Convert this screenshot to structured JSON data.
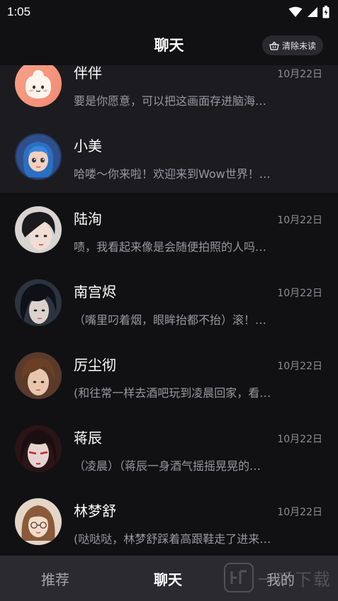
{
  "status_bar": {
    "time": "1:05",
    "icons": [
      "wifi-icon",
      "signal-icon",
      "battery-icon"
    ]
  },
  "header": {
    "title": "聊天",
    "clear_unread_label": "清除未读",
    "clear_icon": "basket-icon"
  },
  "chats": [
    {
      "name": "伴伴",
      "date": "10月22日",
      "preview": "要是你愿意，可以把这画面存进脑海…",
      "pinned": true,
      "avatar": "mascot-avatar"
    },
    {
      "name": "小美",
      "date": "",
      "preview": "哈喽～你来啦！欢迎来到Wow世界！…",
      "pinned": true,
      "avatar": "girl-avatar"
    },
    {
      "name": "陆洵",
      "date": "10月22日",
      "preview": "啧，我看起来像是会随便拍照的人吗…",
      "pinned": false,
      "avatar": "man-avatar"
    },
    {
      "name": "南宫烬",
      "date": "10月22日",
      "preview": "（嘴里叼着烟，眼眸抬都不抬）滚！…",
      "pinned": false,
      "avatar": "man-avatar"
    },
    {
      "name": "厉尘彻",
      "date": "10月22日",
      "preview": "(和往常一样去酒吧玩到凌晨回家，看…",
      "pinned": false,
      "avatar": "man-avatar"
    },
    {
      "name": "蒋辰",
      "date": "10月22日",
      "preview": "（凌晨）（蒋辰一身酒气摇摇晃晃的…",
      "pinned": false,
      "avatar": "man-avatar"
    },
    {
      "name": "林梦舒",
      "date": "10月22日",
      "preview": "(哒哒哒，林梦舒踩着高跟鞋走了进来…",
      "pinned": false,
      "avatar": "woman-avatar"
    }
  ],
  "bottom_nav": {
    "items": [
      {
        "label": "推荐",
        "active": false
      },
      {
        "label": "聊天",
        "active": true
      },
      {
        "label": "我的",
        "active": false
      }
    ],
    "watermark": "一听下载"
  }
}
